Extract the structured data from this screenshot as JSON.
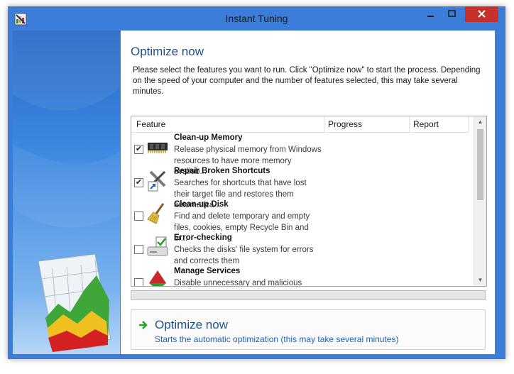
{
  "window": {
    "title": "Instant Tuning"
  },
  "controls": {
    "minimize": "minimize",
    "maximize": "maximize",
    "close": "close"
  },
  "heading": "Optimize now",
  "description": "Please select the features you want to run. Click \"Optimize now\" to start the process. Depending on the speed of your computer and the number of features selected, this may take several minutes.",
  "table": {
    "columns": [
      "Feature",
      "Progress",
      "Report"
    ],
    "rows": [
      {
        "name": "Clean-up Memory",
        "desc": "Release physical memory from Windows resources to have more memory availab...",
        "checked": true,
        "mark": "✔",
        "icon": "memory-chip-icon"
      },
      {
        "name": "Repair Broken Shortcuts",
        "desc": "Searches for shortcuts that have lost their target file and restores them automatica...",
        "checked": true,
        "mark": "✔",
        "icon": "shortcut-repair-icon"
      },
      {
        "name": "Clean-up Disk",
        "desc": "Find and delete temporary and empty files, cookies, empty Recycle Bin and br...",
        "checked": false,
        "mark": "",
        "icon": "broom-icon"
      },
      {
        "name": "Error-checking",
        "desc": "Checks the disks' file system for errors and corrects them",
        "checked": false,
        "mark": "",
        "icon": "disk-check-icon"
      },
      {
        "name": "Manage Services",
        "desc": "Disable unnecessary and malicious",
        "checked": false,
        "mark": "",
        "icon": "services-icon"
      }
    ]
  },
  "progress": {
    "value": 0
  },
  "action": {
    "title": "Optimize now",
    "subtitle": "Starts the automatic optimization (this may take several minutes)"
  },
  "colors": {
    "accent": "#3b7dd8",
    "heading": "#1c4f8e",
    "link": "#1f5fb3",
    "close": "#c7312b"
  }
}
